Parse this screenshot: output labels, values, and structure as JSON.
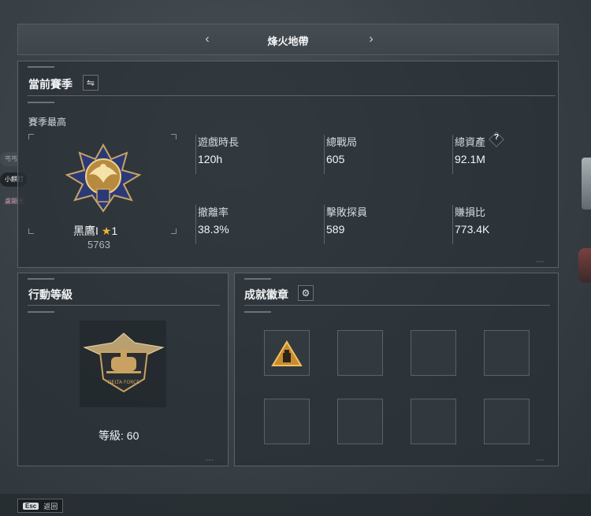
{
  "header": {
    "title": "烽火地帶",
    "prev_icon": "chevron-left-icon",
    "next_icon": "chevron-right-icon"
  },
  "season": {
    "title": "當前賽季",
    "switch_icon": "swap-icon",
    "best_label": "賽季最高",
    "rank_name": "黑鷹I",
    "rank_stars": "1",
    "rank_score": "5763",
    "stats": [
      {
        "label": "遊戲時長",
        "value": "120h"
      },
      {
        "label": "總戰局",
        "value": "605"
      },
      {
        "label": "總資產",
        "value": "92.1M",
        "help": "?"
      },
      {
        "label": "撤離率",
        "value": "38.3%"
      },
      {
        "label": "擊敗探員",
        "value": "589"
      },
      {
        "label": "賺損比",
        "value": "773.4K"
      }
    ]
  },
  "action_level": {
    "title": "行動等級",
    "level_label": "等級:",
    "level_value": "60",
    "emblem_text": "DELTA FORCE"
  },
  "achievements": {
    "title": "成就徽章",
    "settings_icon": "gear-icon",
    "slots": 8,
    "filled": 1
  },
  "side_players": [
    {
      "name": "丐丐"
    },
    {
      "name": "小麒打"
    },
    {
      "name": "盧顯光"
    }
  ],
  "footer": {
    "key": "Esc",
    "label": "返回"
  }
}
